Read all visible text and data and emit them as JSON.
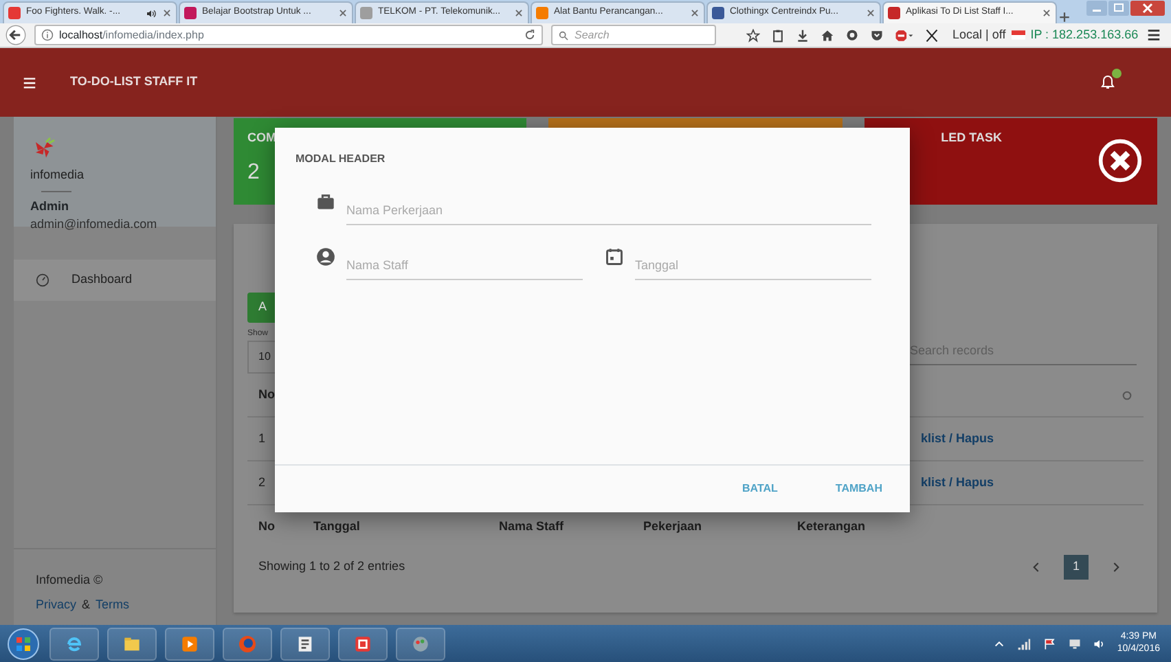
{
  "browser": {
    "tabs": [
      {
        "label": "Foo Fighters. Walk. -...",
        "selected": false,
        "audio": true,
        "color": "#e53935"
      },
      {
        "label": "Belajar Bootstrap Untuk ...",
        "selected": false,
        "audio": false,
        "color": "#c2185b"
      },
      {
        "label": "TELKOM - PT. Telekomunik...",
        "selected": false,
        "audio": false,
        "color": "#9e9e9e"
      },
      {
        "label": "Alat Bantu Perancangan...",
        "selected": false,
        "audio": false,
        "color": "#f57c00"
      },
      {
        "label": "Clothingx Centreindx Pu...",
        "selected": false,
        "audio": false,
        "color": "#3b5998"
      },
      {
        "label": "Aplikasi To Di List Staff I...",
        "selected": true,
        "audio": false,
        "color": "#c62828"
      }
    ],
    "url_host": "localhost",
    "url_path": "/infomedia/index.php",
    "search_placeholder": "Search",
    "proxy": "Local | off",
    "ip": "IP : 182.253.163.66"
  },
  "app": {
    "title": "TO-DO-LIST STAFF IT",
    "sidebar": {
      "brand": "infomedia",
      "user_name": "Admin",
      "user_email": "admin@infomedia.com",
      "menu": [
        {
          "label": "Dashboard"
        }
      ],
      "footer_brand": "Infomedia ©",
      "privacy": "Privacy",
      "amp": "&",
      "terms": "Terms"
    },
    "stats": [
      {
        "kind": "count",
        "label": "COM",
        "value": "2",
        "color": "#2f8a34"
      },
      {
        "kind": "blank",
        "color": "#b5701a"
      },
      {
        "kind": "icon",
        "label": "LED TASK",
        "color": "#8f1010"
      }
    ],
    "table": {
      "add_button": "A",
      "show_label": "Show",
      "page_length": "10",
      "search_placeholder": "Search records",
      "header": [
        "No"
      ],
      "rows": [
        {
          "no": "1",
          "action": "klist / Hapus"
        },
        {
          "no": "2",
          "action": "klist / Hapus"
        }
      ],
      "footer_columns": [
        "No",
        "Tanggal",
        "Nama Staff",
        "Pekerjaan",
        "Keterangan"
      ],
      "info": "Showing 1 to 2 of 2 entries",
      "pages": [
        {
          "label": "1",
          "selected": true
        }
      ]
    },
    "modal": {
      "title": "MODAL HEADER",
      "fields": [
        {
          "kind": "job",
          "placeholder": "Nama Perkerjaan"
        },
        {
          "kind": "staff",
          "placeholder": "Nama Staff"
        },
        {
          "kind": "date",
          "placeholder": "Tanggal"
        }
      ],
      "buttons": [
        "BATAL",
        "TAMBAH"
      ]
    }
  },
  "taskbar": {
    "time": "4:39 PM",
    "date": "10/4/2016"
  }
}
